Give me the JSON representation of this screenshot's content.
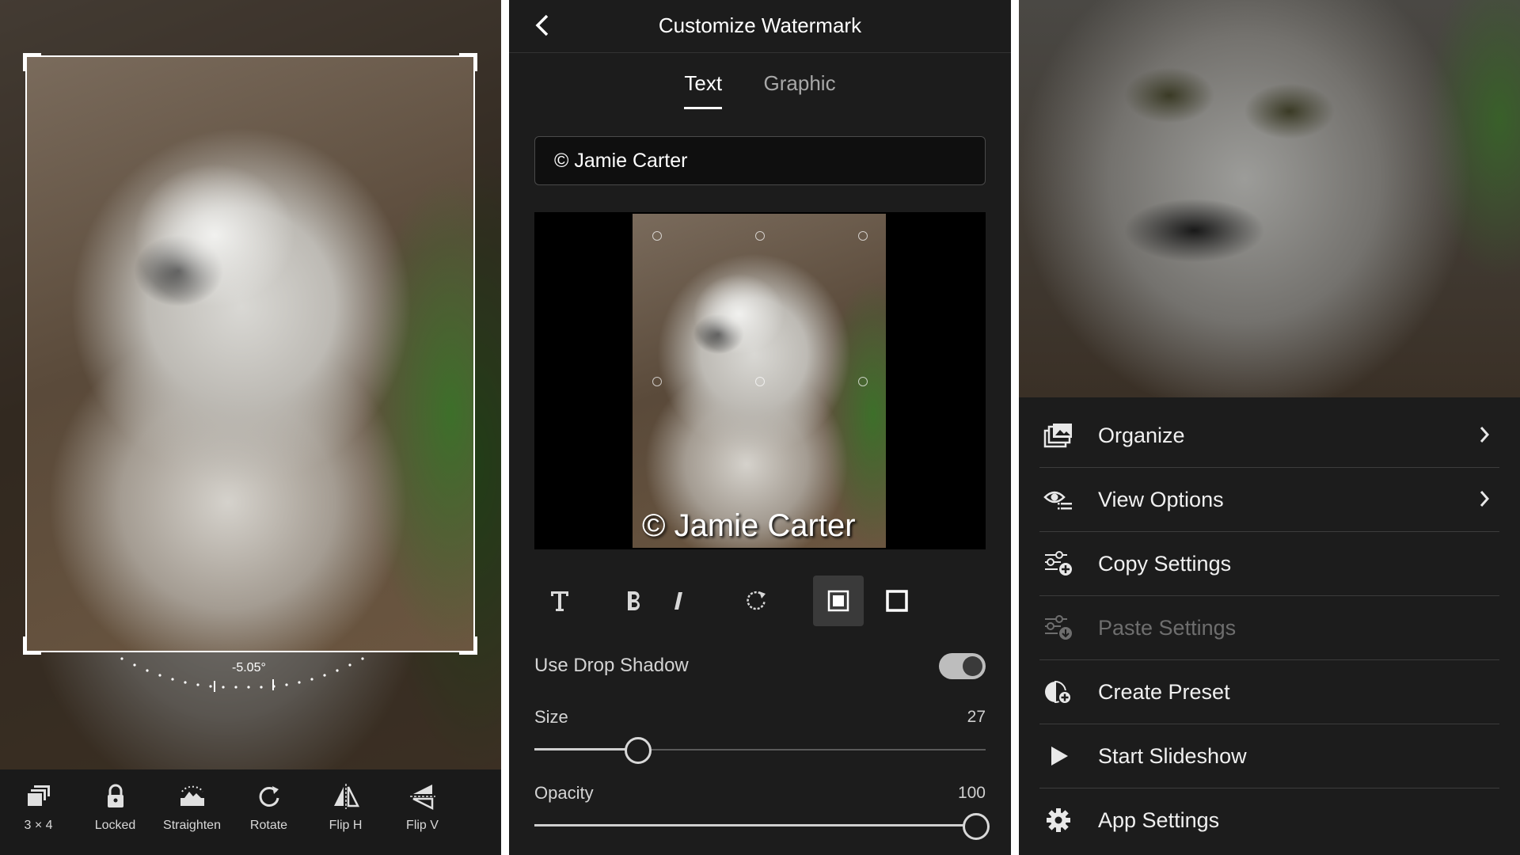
{
  "crop_panel": {
    "angle": "-5.05°",
    "angle_value": -5.05,
    "tools": [
      {
        "icon": "aspect-ratio-icon",
        "label": "3 × 4"
      },
      {
        "icon": "lock-icon",
        "label": "Locked"
      },
      {
        "icon": "straighten-icon",
        "label": "Straighten"
      },
      {
        "icon": "rotate-icon",
        "label": "Rotate"
      },
      {
        "icon": "flip-horizontal-icon",
        "label": "Flip H"
      },
      {
        "icon": "flip-vertical-icon",
        "label": "Flip V"
      }
    ]
  },
  "watermark_panel": {
    "title": "Customize Watermark",
    "tabs": [
      {
        "label": "Text",
        "active": true
      },
      {
        "label": "Graphic",
        "active": false
      }
    ],
    "text_value": "© Jamie Carter",
    "preview_text": "© Jamie Carter",
    "format_tools": [
      "text-style-icon",
      "bold-icon",
      "italic-icon",
      "rotate-icon",
      "inset-box-icon",
      "outline-box-icon"
    ],
    "drop_shadow": {
      "label": "Use Drop Shadow",
      "on": true
    },
    "size": {
      "label": "Size",
      "value": "27",
      "fraction": 0.23
    },
    "opacity": {
      "label": "Opacity",
      "value": "100",
      "fraction": 1.0
    }
  },
  "menu_panel": {
    "items": [
      {
        "label": "Organize",
        "icon": "organize-icon",
        "chevron": true,
        "disabled": false
      },
      {
        "label": "View Options",
        "icon": "view-options-icon",
        "chevron": true,
        "disabled": false
      },
      {
        "label": "Copy Settings",
        "icon": "copy-settings-icon",
        "chevron": false,
        "disabled": false
      },
      {
        "label": "Paste Settings",
        "icon": "paste-settings-icon",
        "chevron": false,
        "disabled": true
      },
      {
        "label": "Create Preset",
        "icon": "create-preset-icon",
        "chevron": false,
        "disabled": false
      },
      {
        "label": "Start Slideshow",
        "icon": "play-icon",
        "chevron": false,
        "disabled": false
      },
      {
        "label": "App Settings",
        "icon": "gear-icon",
        "chevron": false,
        "disabled": false
      }
    ]
  },
  "colors": {
    "background": "#1c1c1c",
    "accent": "#ffffff",
    "toggle_on": "#bdbdbd"
  }
}
